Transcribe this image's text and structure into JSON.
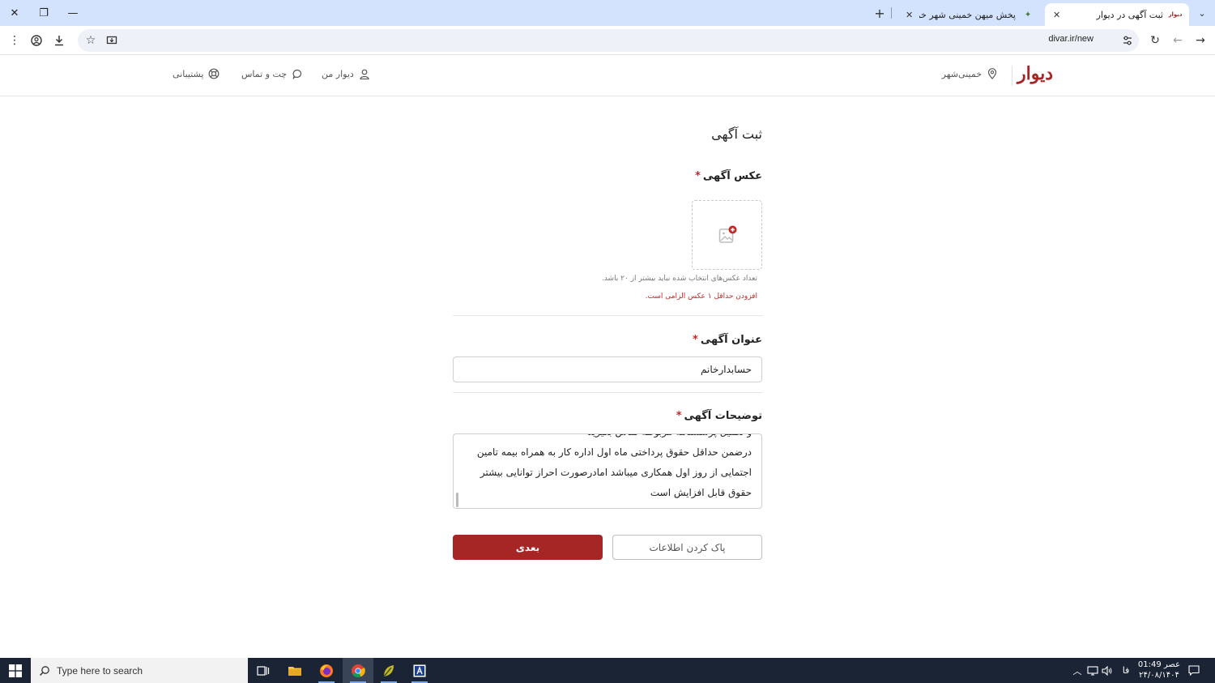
{
  "browser": {
    "tabs": [
      {
        "title": "ثبت آگهی در دیوار",
        "favicon": "دیوار",
        "active": true
      },
      {
        "title": "پخش میهن خمینی شهر خمینی ش",
        "favicon": "✦",
        "active": false
      }
    ],
    "url": "divar.ir/new"
  },
  "site": {
    "logo": "دیوار",
    "city": "خمینی‌شهر",
    "nav": {
      "my_divar": "دیوار من",
      "chat": "چت و تماس",
      "support": "پشتیبانی"
    }
  },
  "form": {
    "page_title": "ثبت آگهی",
    "photo_label": "عکس آگهی",
    "photo_hint": "تعداد عکس‌های انتخاب شده نباید بیشتر از ۲۰ باشد.",
    "photo_error": "افزودن حداقل ۱ عکس الزامی است.",
    "title_label": "عنوان آگهی",
    "title_value": "حسابدارخانم",
    "desc_label": "توضیحات آگهی",
    "desc_lines": "و تکمیل پرسشنامه مربوطه تماس بگیرید\nدرضمن حداقل حقوق پرداختی ماه اول اداره کار به همراه بیمه تامین\nاجتمایی از روز اول همکاری میباشد امادرصورت احراز توانایی بیشتر\nحقوق قابل افزایش است",
    "required_mark": "*",
    "next_button": "بعدی",
    "clear_button": "پاک کردن اطلاعات"
  },
  "taskbar": {
    "search_placeholder": "Type here to search",
    "lang": "فا",
    "time": "عصر 01:49",
    "date": "۲۴/۰۸/۱۴۰۴"
  },
  "colors": {
    "brand": "#a62626",
    "error": "#c62828",
    "tabstrip": "#d3e3fd",
    "taskbar": "#1a2435"
  }
}
